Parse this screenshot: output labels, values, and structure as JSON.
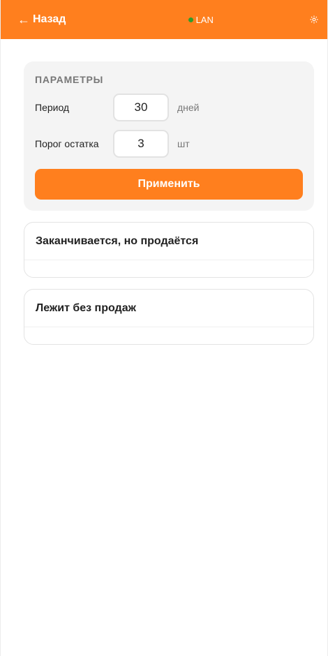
{
  "header": {
    "back_arrow": "←",
    "back_label": "Назад",
    "status_label": "LAN",
    "status_color": "#2e9b2e",
    "accent_color": "#ff7f1e",
    "settings_icon": "gear-icon"
  },
  "params": {
    "title": "ПАРАМЕТРЫ",
    "period": {
      "label": "Период",
      "value": "30",
      "unit": "дней"
    },
    "threshold": {
      "label": "Порог остатка",
      "value": "3",
      "unit": "шт"
    },
    "apply_label": "Применить"
  },
  "sections": [
    {
      "title": "Заканчивается, но продаётся"
    },
    {
      "title": "Лежит без продаж"
    }
  ]
}
